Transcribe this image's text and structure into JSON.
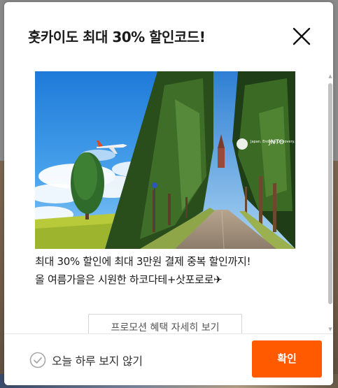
{
  "modal": {
    "title": "홋카이도 최대 30% 할인코드!",
    "close_icon": "close-icon"
  },
  "banner": {
    "logo_text_1": "Japan. Endless Discovery.",
    "logo_text_2": "JNTO",
    "icons": [
      "airplane",
      "tree",
      "road",
      "logo"
    ]
  },
  "promo": {
    "line1": "최대 30% 할인에 최대 3만원 결제 중복 할인까지!",
    "line2": "올 여름가을은 시원한 하코다테+삿포로로✈"
  },
  "buttons": {
    "details_label": "프로모션 혜택 자세히 보기",
    "confirm_label": "확인"
  },
  "footer": {
    "dont_show_label": "오늘 하루 보지 않기"
  },
  "colors": {
    "accent": "#ff5a00",
    "title_text": "#1a1a1a"
  }
}
